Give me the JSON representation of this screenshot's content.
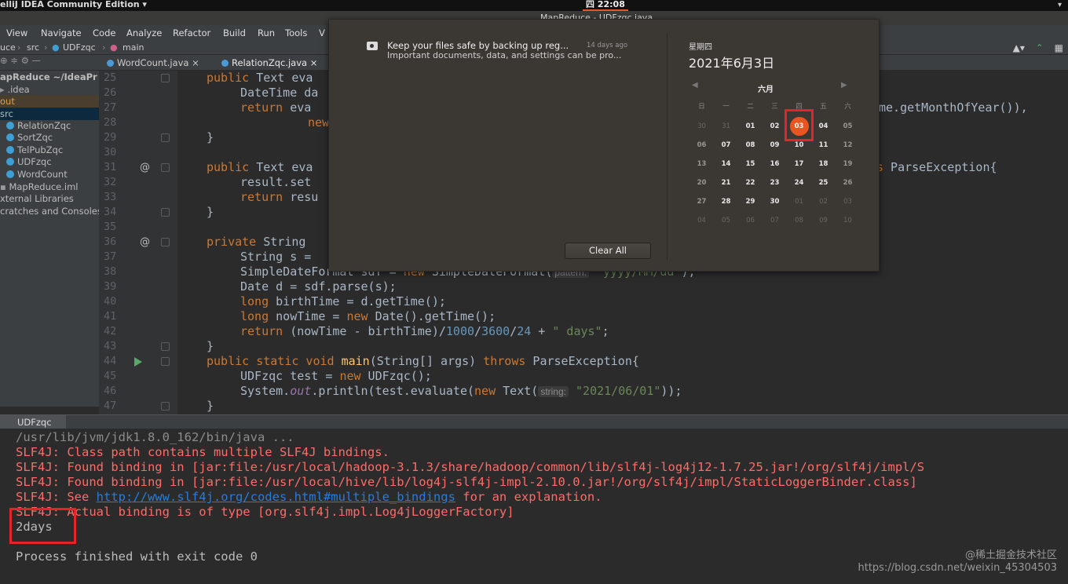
{
  "topbar": {
    "app_name": "elliJ IDEA Community Edition ▾",
    "clock": "四 22:08",
    "sys_icons": "▾"
  },
  "window": {
    "title": "MapReduce - UDFzqc.java"
  },
  "menu": [
    "View",
    "Navigate",
    "Code",
    "Analyze",
    "Refactor",
    "Build",
    "Run",
    "Tools",
    "V"
  ],
  "breadcrumb": [
    "uce",
    "src",
    "UDFzqc",
    "main"
  ],
  "tabs": [
    {
      "label": "WordCount.java ×"
    },
    {
      "label": "RelationZqc.java ×"
    }
  ],
  "project": {
    "items": [
      {
        "label": "apReduce ~/IdeaPr"
      },
      {
        "label": ".idea"
      },
      {
        "label": "out"
      },
      {
        "label": "src"
      },
      {
        "label": "RelationZqc"
      },
      {
        "label": "SortZqc"
      },
      {
        "label": "TelPubZqc"
      },
      {
        "label": "UDFzqc"
      },
      {
        "label": "WordCount"
      },
      {
        "label": "MapReduce.iml"
      },
      {
        "label": "xternal Libraries"
      },
      {
        "label": "cratches and Consoles"
      }
    ]
  },
  "editor": {
    "line_numbers": [
      "25",
      "26",
      "27",
      "28",
      "29",
      "30",
      "31",
      "32",
      "33",
      "34",
      "35",
      "36",
      "37",
      "38",
      "39",
      "40",
      "41",
      "42",
      "43",
      "44",
      "45",
      "46",
      "47"
    ],
    "lines": [
      {
        "kw": "public",
        "rest": " Text eva"
      },
      {
        "kw": "",
        "rest": "DateTime da"
      },
      {
        "kw": "return",
        "rest": " eva"
      },
      {
        "kw": "new",
        "rest": ""
      },
      {
        "kw": "",
        "rest": "}"
      },
      {
        "kw": "",
        "rest": ""
      },
      {
        "kw": "public",
        "rest": " Text eva"
      },
      {
        "kw": "",
        "rest": "result.set"
      },
      {
        "kw": "return",
        "rest": " resu"
      },
      {
        "kw": "",
        "rest": "}"
      },
      {
        "kw": "",
        "rest": ""
      },
      {
        "kw": "private",
        "rest": " String"
      },
      {
        "kw": "",
        "rest": "String s = "
      },
      {
        "kw": "",
        "rest": "SimpleDateFormat sdf = "
      },
      {
        "kw": "",
        "rest": "Date d = sdf.parse(s);"
      },
      {
        "kw": "long",
        "rest": " birthTime = d.getTime();"
      },
      {
        "kw": "long",
        "rest": " nowTime = "
      },
      {
        "kw": "return",
        "rest": " (nowTime - birthTime)/"
      },
      {
        "kw": "",
        "rest": "}"
      },
      {
        "kw": "public static void",
        "rest": ""
      },
      {
        "kw": "",
        "rest": "UDFzqc test = "
      },
      {
        "kw": "",
        "rest": "System."
      },
      {
        "kw": "",
        "rest": "}"
      }
    ],
    "fragments": {
      "l27_tail": "me.getMonthOfYear()),",
      "l31_tail": "s ParseException{",
      "l38_new": "new",
      "l38_cls": " SimpleDateFormat(",
      "l38_hint": "pattern:",
      "l38_str": " \"yyyy/MM/dd\"",
      "l38_end": ");",
      "l41_new": "new",
      "l41_end": " Date().getTime();",
      "l42_n1": "1000",
      "l42_n2": "3600",
      "l42_n3": "24",
      "l42_op": " + ",
      "l42_str": "\" days\"",
      "l42_end": ";",
      "l44_fn": "main",
      "l44_args": "(String[] args) ",
      "l44_throws": "throws",
      "l44_end": " ParseException{",
      "l45_new": "new",
      "l45_end": " UDFzqc();",
      "l46_out": "out",
      "l46_mid": ".println(test.evaluate(",
      "l46_new": "new",
      "l46_cls": " Text(",
      "l46_hint": "string:",
      "l46_str": "\"2021/06/01\"",
      "l46_end": "));",
      "slash": "/",
      "divs": "/"
    }
  },
  "run": {
    "tab_label": "UDFzqc",
    "lines": [
      {
        "cls": "cmd",
        "text": "/usr/lib/jvm/jdk1.8.0_162/bin/java ..."
      },
      {
        "cls": "err",
        "text": "SLF4J: Class path contains multiple SLF4J bindings."
      },
      {
        "cls": "err",
        "text": "SLF4J: Found binding in [jar:file:/usr/local/hadoop-3.1.3/share/hadoop/common/lib/slf4j-log4j12-1.7.25.jar!/org/slf4j/impl/S"
      },
      {
        "cls": "err",
        "text": "SLF4J: Found binding in [jar:file:/usr/local/hive/lib/log4j-slf4j-impl-2.10.0.jar!/org/slf4j/impl/StaticLoggerBinder.class]"
      },
      {
        "cls": "err",
        "text": "SLF4J: See "
      },
      {
        "cls": "err",
        "text": "SLF4J: Actual binding is of type [org.slf4j.impl.Log4jLoggerFactory]"
      },
      {
        "cls": "out",
        "text": "2days"
      },
      {
        "cls": "out",
        "text": ""
      },
      {
        "cls": "out",
        "text": "Process finished with exit code 0"
      }
    ],
    "see_link": "http://www.slf4j.org/codes.html#multiple_bindings",
    "see_tail": " for an explanation."
  },
  "notification": {
    "title": "Keep your files safe by backing up reg...",
    "time": "14 days ago",
    "body": "Important documents, data, and settings can be pro...",
    "clear_all": "Clear All"
  },
  "calendar": {
    "weekday": "星期四",
    "full_date": "2021年6月3日",
    "month": "六月",
    "prev": "◀",
    "next": "▶",
    "dow": [
      "日",
      "一",
      "二",
      "三",
      "四",
      "五",
      "六"
    ],
    "weeks": [
      [
        "30",
        "31",
        "01",
        "02",
        "03",
        "04",
        "05"
      ],
      [
        "06",
        "07",
        "08",
        "09",
        "10",
        "11",
        "12"
      ],
      [
        "13",
        "14",
        "15",
        "16",
        "17",
        "18",
        "19"
      ],
      [
        "20",
        "21",
        "22",
        "23",
        "24",
        "25",
        "26"
      ],
      [
        "27",
        "28",
        "29",
        "30",
        "01",
        "02",
        "03"
      ],
      [
        "04",
        "05",
        "06",
        "07",
        "08",
        "09",
        "10"
      ]
    ],
    "today": "03",
    "accent_color": "#e95420"
  },
  "watermark": {
    "line1": "@稀土掘金技术社区",
    "line2": "https://blog.csdn.net/weixin_45304503"
  },
  "colors": {
    "highlight_box": "#e5232a"
  }
}
